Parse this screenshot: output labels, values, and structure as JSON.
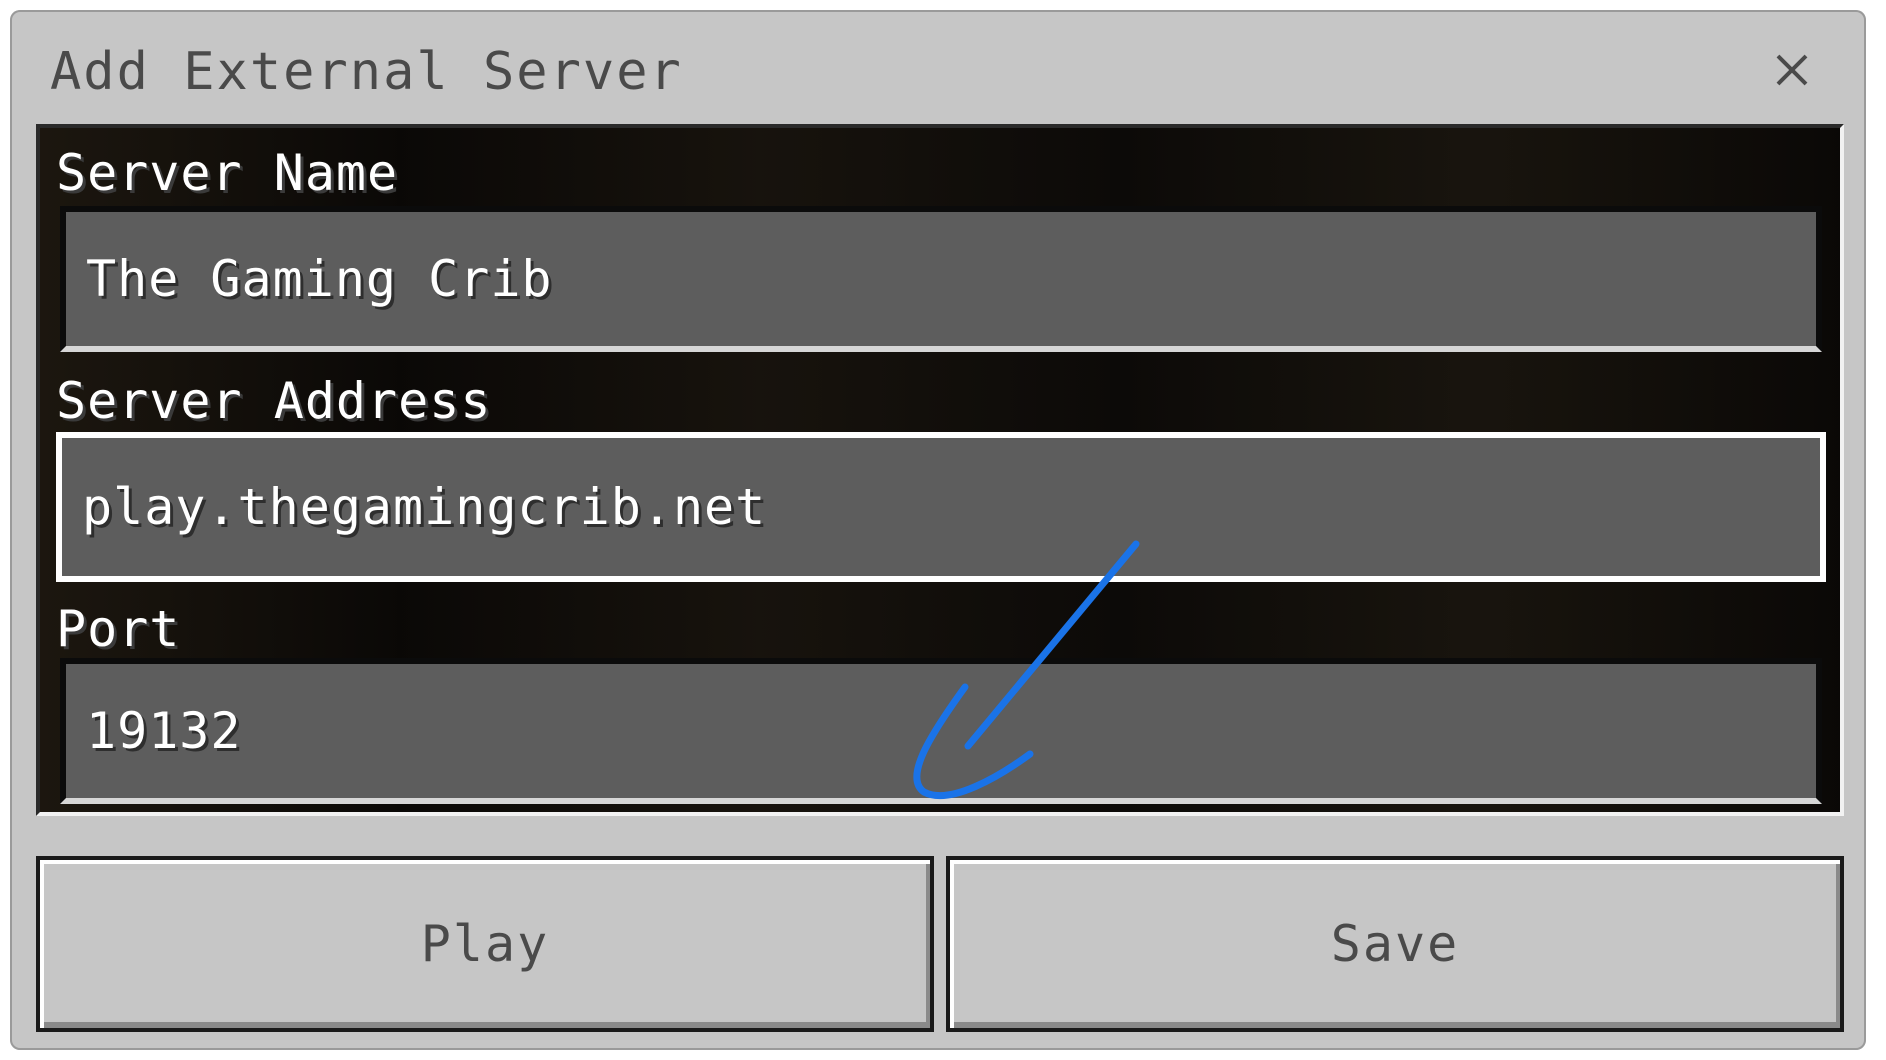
{
  "dialog": {
    "title": "Add External Server",
    "close_icon": "close-icon"
  },
  "fields": {
    "server_name": {
      "label": "Server Name",
      "value": "The Gaming Crib"
    },
    "server_address": {
      "label": "Server Address",
      "value": "play.thegamingcrib.net"
    },
    "port": {
      "label": "Port",
      "value": "19132"
    }
  },
  "buttons": {
    "play_label": "Play",
    "save_label": "Save"
  },
  "annotation": {
    "icon": "arrow-icon",
    "color": "#1a73e8"
  }
}
